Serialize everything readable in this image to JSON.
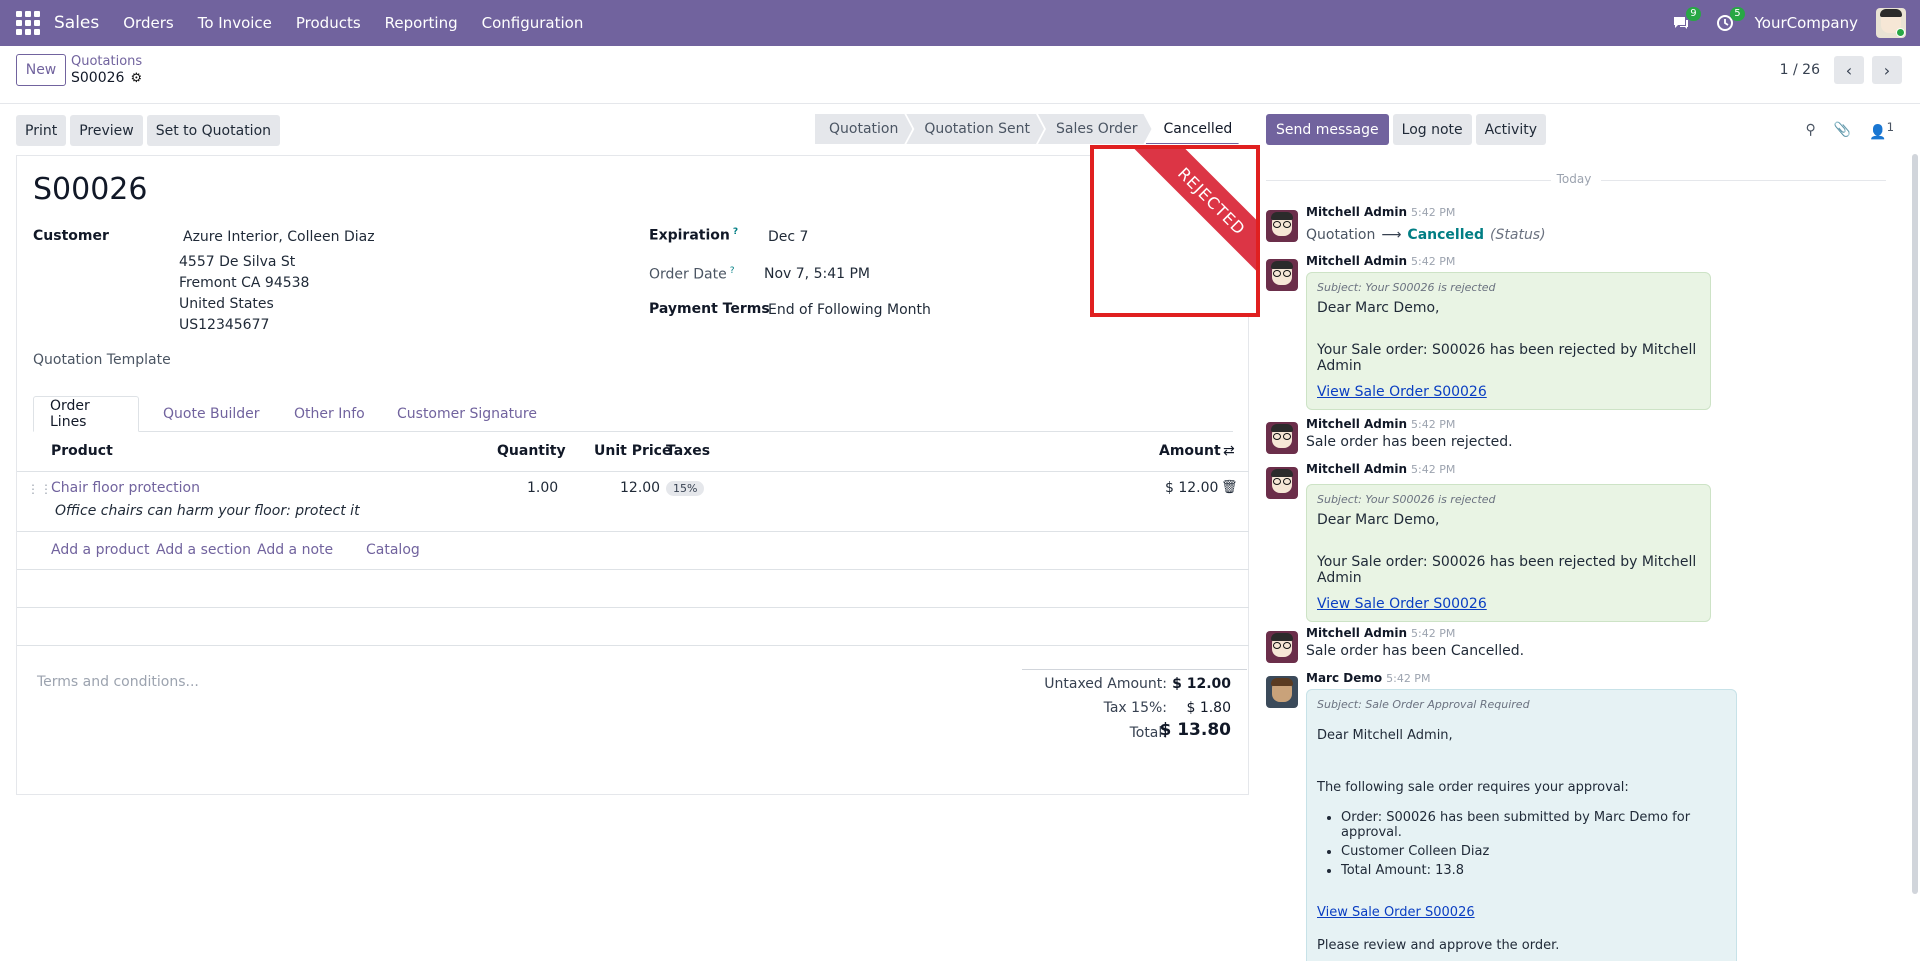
{
  "topbar": {
    "app": "Sales",
    "menu": [
      "Orders",
      "To Invoice",
      "Products",
      "Reporting",
      "Configuration"
    ],
    "messages_count": "9",
    "activities_count": "5",
    "company": "YourCompany"
  },
  "control": {
    "new_label": "New",
    "breadcrumb_parent": "Quotations",
    "breadcrumb_current": "S00026",
    "pager": "1 / 26"
  },
  "actions": {
    "print": "Print",
    "preview": "Preview",
    "set_quotation": "Set to Quotation"
  },
  "stages": [
    "Quotation",
    "Quotation Sent",
    "Sales Order",
    "Cancelled"
  ],
  "ribbon": "REJECTED",
  "form": {
    "name": "S00026",
    "customer_label": "Customer",
    "customer_name": "Azure Interior, Colleen Diaz",
    "address": [
      "4557 De Silva St",
      "Fremont CA 94538",
      "United States",
      "US12345677"
    ],
    "template_label": "Quotation Template",
    "expiration_label": "Expiration",
    "expiration": "Dec 7",
    "order_date_label": "Order Date",
    "order_date": "Nov 7, 5:41 PM",
    "payment_terms_label": "Payment Terms",
    "payment_terms": "End of Following Month"
  },
  "tabs": [
    "Order Lines",
    "Quote Builder",
    "Other Info",
    "Customer Signature"
  ],
  "table": {
    "headers": {
      "product": "Product",
      "quantity": "Quantity",
      "unit_price": "Unit Price",
      "taxes": "Taxes",
      "amount": "Amount"
    },
    "rows": [
      {
        "product": "Chair floor protection",
        "description": "Office chairs can harm your floor: protect it",
        "quantity": "1.00",
        "unit_price": "12.00",
        "tax": "15%",
        "amount": "$ 12.00"
      }
    ],
    "add_links": [
      "Add a product",
      "Add a section",
      "Add a note",
      "Catalog"
    ]
  },
  "terms_placeholder": "Terms and conditions...",
  "totals": {
    "untaxed_label": "Untaxed Amount:",
    "untaxed": "$ 12.00",
    "tax_label": "Tax 15%:",
    "tax": "$ 1.80",
    "total_label": "Total:",
    "total": "$ 13.80"
  },
  "chatter": {
    "send_message": "Send message",
    "log_note": "Log note",
    "activity": "Activity",
    "followers_count": "1",
    "today": "Today",
    "messages": [
      {
        "author": "Mitchell Admin",
        "time": "5:42 PM",
        "old": "Quotation",
        "new": "Cancelled",
        "field": "(Status)"
      },
      {
        "author": "Mitchell Admin",
        "time": "5:42 PM",
        "subject": "Subject: Your S00026 is rejected",
        "greeting": "Dear Marc Demo,",
        "body": "Your Sale order: S00026 has been rejected by Mitchell Admin",
        "link": "View Sale Order S00026"
      },
      {
        "author": "Mitchell Admin",
        "time": "5:42 PM",
        "text": "Sale order has been rejected."
      },
      {
        "author": "Mitchell Admin",
        "time": "5:42 PM",
        "subject": "Subject: Your S00026 is rejected",
        "greeting": "Dear Marc Demo,",
        "body": "Your Sale order: S00026 has been rejected by Mitchell Admin",
        "link": "View Sale Order S00026"
      },
      {
        "author": "Mitchell Admin",
        "time": "5:42 PM",
        "text": "Sale order has been Cancelled."
      },
      {
        "author": "Marc Demo",
        "time": "5:42 PM",
        "subject": "Subject: Sale Order Approval Required",
        "greeting": "Dear Mitchell Admin,",
        "intro": "The following sale order requires your approval:",
        "bullets": [
          "Order: S00026 has been submitted by Marc Demo for approval.",
          "Customer Colleen Diaz",
          "Total Amount: 13.8"
        ],
        "link": "View Sale Order S00026",
        "closing": "Please review and approve the order."
      }
    ]
  },
  "colors": {
    "brand": "#71639e",
    "ribbon": "#dc3545",
    "annotation": "#e02020"
  }
}
